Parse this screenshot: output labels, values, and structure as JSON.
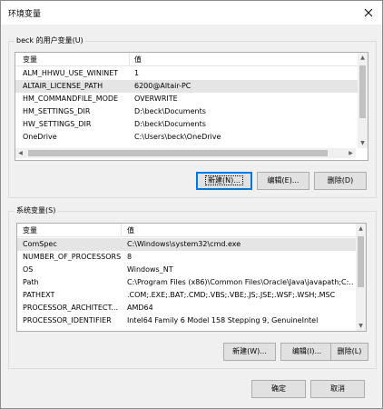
{
  "window": {
    "title": "环境变量"
  },
  "user_vars": {
    "group_label": "beck 的用户变量(U)",
    "headers": {
      "name": "变量",
      "value": "值"
    },
    "rows": [
      {
        "name": "ALM_HHWU_USE_WININET",
        "value": "1"
      },
      {
        "name": "ALTAIR_LICENSE_PATH",
        "value": "6200@Altair-PC"
      },
      {
        "name": "HM_COMMANDFILE_MODE",
        "value": "OVERWRITE"
      },
      {
        "name": "HM_SETTINGS_DIR",
        "value": "D:\\beck\\Documents"
      },
      {
        "name": "HW_SETTINGS_DIR",
        "value": "D:\\beck\\Documents"
      },
      {
        "name": "OneDrive",
        "value": "C:\\Users\\beck\\OneDrive"
      }
    ],
    "buttons": {
      "new": "新建(N)...",
      "edit": "编辑(E)...",
      "delete": "删除(D)"
    }
  },
  "system_vars": {
    "group_label": "系统变量(S)",
    "headers": {
      "name": "变量",
      "value": "值"
    },
    "rows": [
      {
        "name": "ComSpec",
        "value": "C:\\Windows\\system32\\cmd.exe"
      },
      {
        "name": "NUMBER_OF_PROCESSORS",
        "value": "8"
      },
      {
        "name": "OS",
        "value": "Windows_NT"
      },
      {
        "name": "Path",
        "value": "C:\\Program Files (x86)\\Common Files\\Oracle\\Java\\javapath;C:..."
      },
      {
        "name": "PATHEXT",
        "value": ".COM;.EXE;.BAT;.CMD;.VBS;.VBE;.JS;.JSE;.WSF;.WSH;.MSC"
      },
      {
        "name": "PROCESSOR_ARCHITECT...",
        "value": "AMD64"
      },
      {
        "name": "PROCESSOR_IDENTIFIER",
        "value": "Intel64 Family 6 Model 158 Stepping 9, GenuineIntel"
      }
    ],
    "buttons": {
      "new": "新建(W)...",
      "edit": "编辑(I)...",
      "delete": "删除(L)"
    }
  },
  "footer": {
    "ok": "确定",
    "cancel": "取消"
  }
}
